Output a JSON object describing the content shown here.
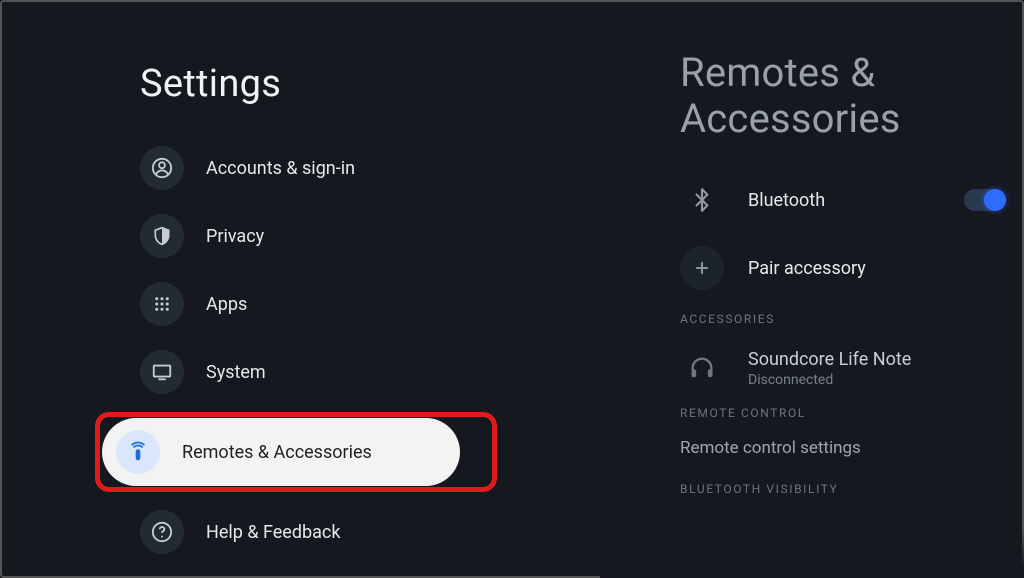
{
  "page_title": "Settings",
  "sidebar": {
    "items": [
      {
        "label": "Accounts & sign-in"
      },
      {
        "label": "Privacy"
      },
      {
        "label": "Apps"
      },
      {
        "label": "System"
      },
      {
        "label": "Remotes & Accessories"
      },
      {
        "label": "Help & Feedback"
      }
    ]
  },
  "detail": {
    "title": "Remotes & Accessories",
    "bluetooth_label": "Bluetooth",
    "bluetooth_on": true,
    "pair_label": "Pair accessory",
    "sections": {
      "accessories": "ACCESSORIES",
      "remote": "REMOTE CONTROL",
      "bt_vis": "BLUETOOTH VISIBILITY"
    },
    "accessory": {
      "name": "Soundcore Life Note",
      "status": "Disconnected"
    },
    "remote_settings_label": "Remote control settings"
  }
}
